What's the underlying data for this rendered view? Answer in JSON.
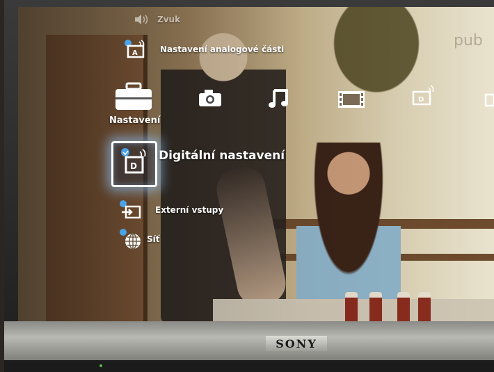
{
  "tv": {
    "brand": "SONY"
  },
  "scene": {
    "watermark": "pub"
  },
  "menu": {
    "top_items": [
      {
        "label": "Zvuk",
        "icon": "speaker-icon"
      },
      {
        "label": "Nastavení analogové části",
        "icon": "analog-tv-settings-icon"
      }
    ],
    "categories": [
      {
        "label": "Nastavení",
        "icon": "toolbox-icon",
        "selected": true
      },
      {
        "label": "",
        "icon": "camera-icon"
      },
      {
        "label": "",
        "icon": "music-note-icon"
      },
      {
        "label": "",
        "icon": "film-icon"
      },
      {
        "label": "",
        "icon": "digital-tv-icon"
      }
    ],
    "selected_item": {
      "label": "Digitální nastavení",
      "icon": "digital-tv-settings-icon"
    },
    "bottom_items": [
      {
        "label": "Externí vstupy",
        "icon": "external-inputs-icon"
      },
      {
        "label": "Síť",
        "icon": "network-globe-icon"
      }
    ]
  }
}
